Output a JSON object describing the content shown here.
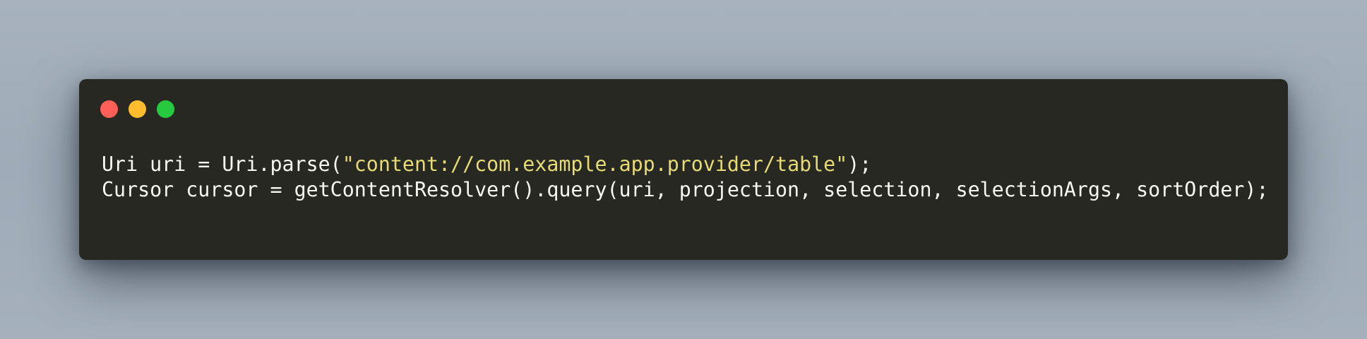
{
  "window": {
    "controls": [
      {
        "name": "close",
        "color": "#ff5f56"
      },
      {
        "name": "minimize",
        "color": "#ffbd2e"
      },
      {
        "name": "maximize",
        "color": "#27c93f"
      }
    ]
  },
  "code": {
    "language": "java",
    "colors": {
      "background": "#272822",
      "text": "#f8f8f2",
      "string": "#e6db74"
    },
    "lines": [
      {
        "before": "Uri uri = Uri.parse(",
        "string": "\"content://com.example.app.provider/table\"",
        "after": ");"
      },
      {
        "text": "Cursor cursor = getContentResolver().query(uri, projection, selection, selectionArgs, sortOrder);"
      }
    ]
  }
}
